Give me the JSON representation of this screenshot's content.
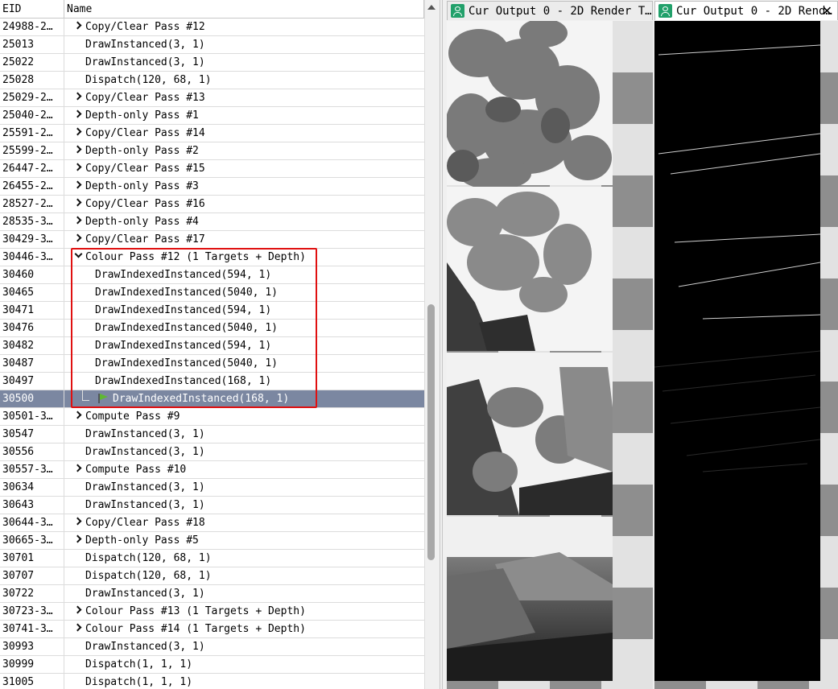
{
  "event_list": {
    "columns": {
      "eid": "EID",
      "name": "Name"
    },
    "rows": [
      {
        "eid": "24988-2…",
        "name": "Copy/Clear Pass #12",
        "kind": "group-closed"
      },
      {
        "eid": "25013",
        "name": "DrawInstanced(3, 1)",
        "kind": "item"
      },
      {
        "eid": "25022",
        "name": "DrawInstanced(3, 1)",
        "kind": "item"
      },
      {
        "eid": "25028",
        "name": "Dispatch(120, 68, 1)",
        "kind": "item"
      },
      {
        "eid": "25029-2…",
        "name": "Copy/Clear Pass #13",
        "kind": "group-closed"
      },
      {
        "eid": "25040-2…",
        "name": "Depth-only Pass #1",
        "kind": "group-closed"
      },
      {
        "eid": "25591-2…",
        "name": "Copy/Clear Pass #14",
        "kind": "group-closed"
      },
      {
        "eid": "25599-2…",
        "name": "Depth-only Pass #2",
        "kind": "group-closed"
      },
      {
        "eid": "26447-2…",
        "name": "Copy/Clear Pass #15",
        "kind": "group-closed"
      },
      {
        "eid": "26455-2…",
        "name": "Depth-only Pass #3",
        "kind": "group-closed"
      },
      {
        "eid": "28527-2…",
        "name": "Copy/Clear Pass #16",
        "kind": "group-closed"
      },
      {
        "eid": "28535-3…",
        "name": "Depth-only Pass #4",
        "kind": "group-closed"
      },
      {
        "eid": "30429-3…",
        "name": "Copy/Clear Pass #17",
        "kind": "group-closed"
      },
      {
        "eid": "30446-3…",
        "name": "Colour Pass #12 (1 Targets + Depth)",
        "kind": "group-open"
      },
      {
        "eid": "30460",
        "name": "DrawIndexedInstanced(594, 1)",
        "kind": "child"
      },
      {
        "eid": "30465",
        "name": "DrawIndexedInstanced(5040, 1)",
        "kind": "child"
      },
      {
        "eid": "30471",
        "name": "DrawIndexedInstanced(594, 1)",
        "kind": "child"
      },
      {
        "eid": "30476",
        "name": "DrawIndexedInstanced(5040, 1)",
        "kind": "child"
      },
      {
        "eid": "30482",
        "name": "DrawIndexedInstanced(594, 1)",
        "kind": "child"
      },
      {
        "eid": "30487",
        "name": "DrawIndexedInstanced(5040, 1)",
        "kind": "child"
      },
      {
        "eid": "30497",
        "name": "DrawIndexedInstanced(168, 1)",
        "kind": "child"
      },
      {
        "eid": "30500",
        "name": "DrawIndexedInstanced(168, 1)",
        "kind": "current"
      },
      {
        "eid": "30501-3…",
        "name": "Compute Pass #9",
        "kind": "group-closed"
      },
      {
        "eid": "30547",
        "name": "DrawInstanced(3, 1)",
        "kind": "item"
      },
      {
        "eid": "30556",
        "name": "DrawInstanced(3, 1)",
        "kind": "item"
      },
      {
        "eid": "30557-3…",
        "name": "Compute Pass #10",
        "kind": "group-closed"
      },
      {
        "eid": "30634",
        "name": "DrawInstanced(3, 1)",
        "kind": "item"
      },
      {
        "eid": "30643",
        "name": "DrawInstanced(3, 1)",
        "kind": "item"
      },
      {
        "eid": "30644-3…",
        "name": "Copy/Clear Pass #18",
        "kind": "group-closed"
      },
      {
        "eid": "30665-3…",
        "name": "Depth-only Pass #5",
        "kind": "group-closed"
      },
      {
        "eid": "30701",
        "name": "Dispatch(120, 68, 1)",
        "kind": "item"
      },
      {
        "eid": "30707",
        "name": "Dispatch(120, 68, 1)",
        "kind": "item"
      },
      {
        "eid": "30722",
        "name": "DrawInstanced(3, 1)",
        "kind": "item"
      },
      {
        "eid": "30723-3…",
        "name": "Colour Pass #13 (1 Targets + Depth)",
        "kind": "group-closed"
      },
      {
        "eid": "30741-3…",
        "name": "Colour Pass #14 (1 Targets + Depth)",
        "kind": "group-closed"
      },
      {
        "eid": "30993",
        "name": "DrawInstanced(3, 1)",
        "kind": "item"
      },
      {
        "eid": "30999",
        "name": "Dispatch(1, 1, 1)",
        "kind": "item"
      },
      {
        "eid": "31005",
        "name": "Dispatch(1, 1, 1)",
        "kind": "item"
      }
    ]
  },
  "viewers": {
    "left_tab": {
      "title": "Cur Output 0 - 2D Render T…"
    },
    "right_tab": {
      "title": "Cur Output 0 - 2D Rend…",
      "close": "✕"
    }
  },
  "colors": {
    "selection": "#7b87a1",
    "highlight_box": "#e01010",
    "tab_icon": "#21a06a",
    "current_flag": "#5fb832"
  }
}
